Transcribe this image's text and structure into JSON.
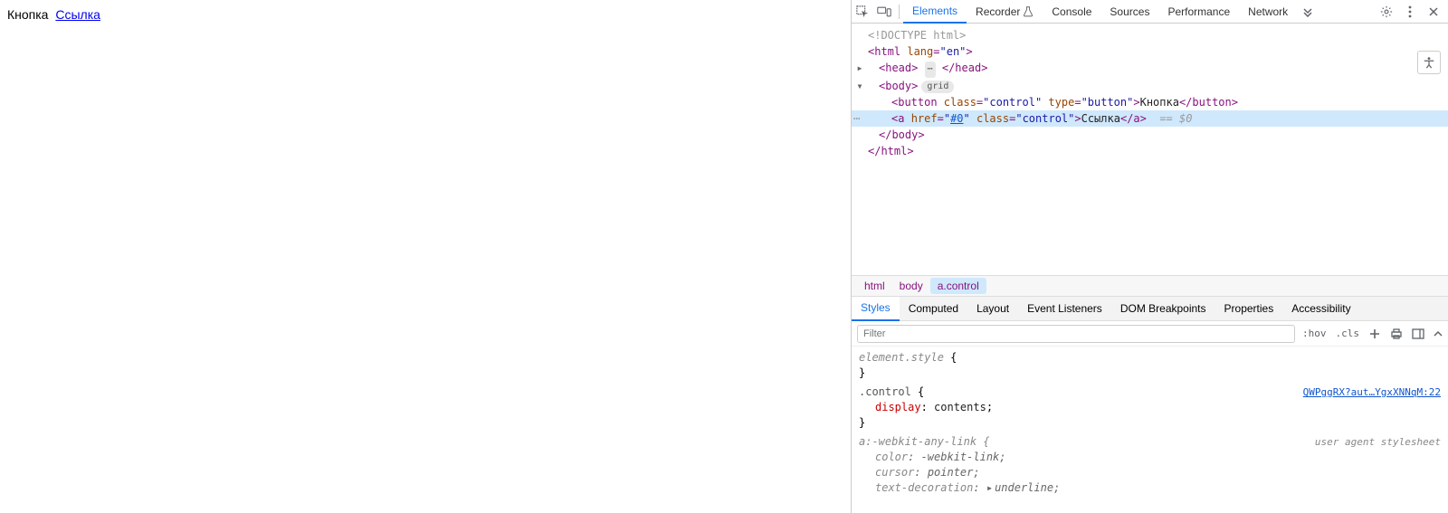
{
  "page": {
    "button_text": "Кнопка",
    "link_text": "Ссылка"
  },
  "tabs": {
    "elements": "Elements",
    "recorder": "Recorder",
    "console": "Console",
    "sources": "Sources",
    "performance": "Performance",
    "network": "Network"
  },
  "dom": {
    "doctype": "<!DOCTYPE html>",
    "html_open": "<html lang=\"en\">",
    "head": {
      "open": "<head>",
      "close": "</head>"
    },
    "body_open": "<body>",
    "body_badge": "grid",
    "button_line": {
      "tag_open": "<button",
      "class_attr": "class",
      "class_val": "\"control\"",
      "type_attr": "type",
      "type_val": "\"button\"",
      "text": "Кнопка",
      "tag_close": "</button>"
    },
    "a_line": {
      "tag_open": "<a",
      "href_attr": "href",
      "href_val": "\"#0\"",
      "class_attr": "class",
      "class_val": "\"control\"",
      "text": "Ссылка",
      "tag_close": "</a>",
      "sel_marker": "== $0"
    },
    "body_close": "</body>",
    "html_close": "</html>"
  },
  "crumbs": {
    "html": "html",
    "body": "body",
    "a": "a.control"
  },
  "subtabs": {
    "styles": "Styles",
    "computed": "Computed",
    "layout": "Layout",
    "listeners": "Event Listeners",
    "dom_bp": "DOM Breakpoints",
    "properties": "Properties",
    "a11y": "Accessibility"
  },
  "filter": {
    "placeholder": "Filter",
    "hov": ":hov",
    "cls": ".cls"
  },
  "rules": {
    "elstyle": {
      "sel": "element.style",
      "brace_open": " {",
      "brace_close": "}"
    },
    "control": {
      "sel": ".control",
      "brace_open": " {",
      "display_name": "display",
      "display_val": "contents",
      "brace_close": "}",
      "source": "QWPggRX?aut…YgxXNNqM:22"
    },
    "anylink": {
      "sel": "a:-webkit-any-link",
      "brace_open": " {",
      "color_name": "color",
      "color_val": "-webkit-link",
      "cursor_name": "cursor",
      "cursor_val": "pointer",
      "textdec_name": "text-decoration",
      "textdec_val": "underline",
      "brace_close": "}",
      "source": "user agent stylesheet"
    }
  }
}
